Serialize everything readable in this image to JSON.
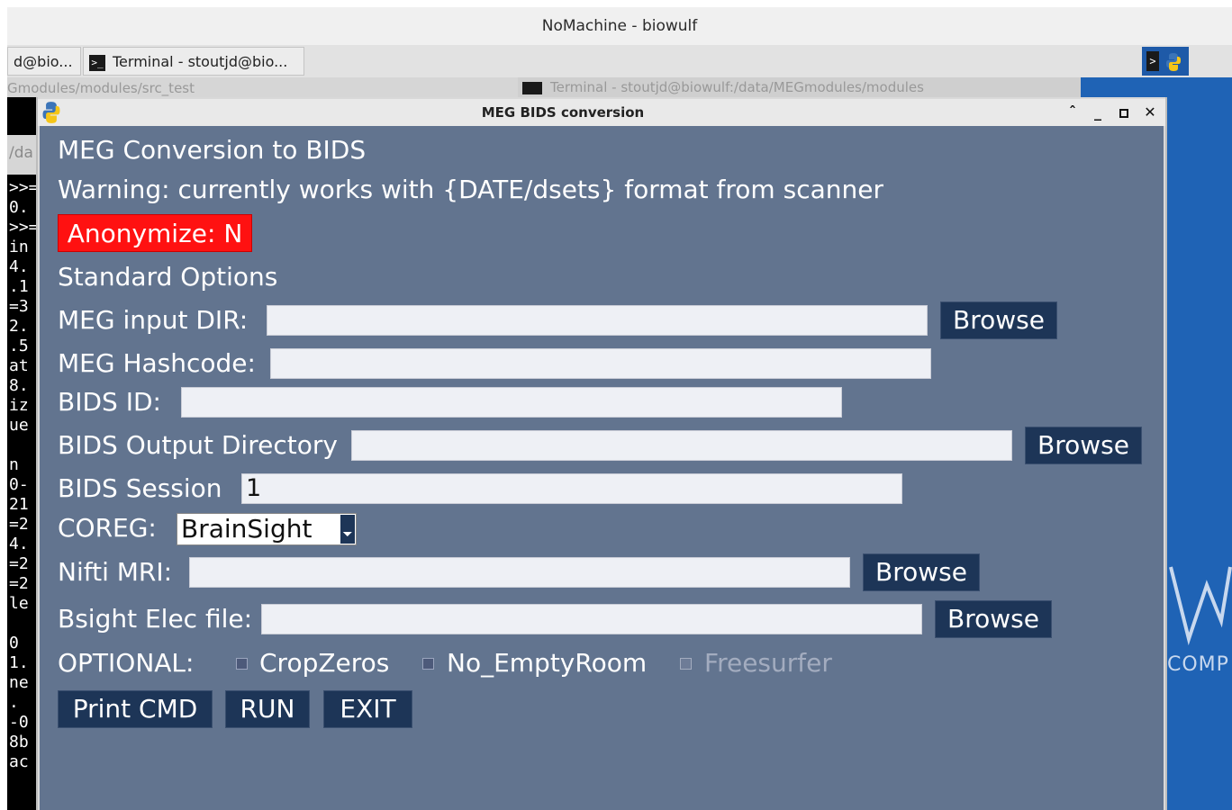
{
  "app": {
    "title": "NoMachine - biowulf"
  },
  "taskbar": {
    "items": [
      {
        "label": "d@bio..."
      },
      {
        "label": "Terminal - stoutjd@bio..."
      }
    ]
  },
  "background": {
    "left_window_title": "Gmodules/modules/src_test",
    "right_window_title": "Terminal - stoutjd@biowulf:/data/MEGmodules/modules",
    "left_path_fragment": "/da",
    "desktop_text": "COMP",
    "terminal_lines": [
      ">>=",
      "0.",
      ">>=",
      "in",
      "4.",
      ".1",
      "=3",
      "2.",
      ".5",
      "at",
      "8.",
      "iz",
      "ue",
      "",
      "n",
      "0-",
      "21",
      "=2",
      "4.",
      "=2",
      "=2",
      "le",
      "",
      "0",
      "1.",
      "ne",
      ".",
      "-0",
      "8b",
      "ac"
    ]
  },
  "dialog": {
    "title": "MEG BIDS conversion",
    "heading": "MEG Conversion to BIDS",
    "warning": "Warning: currently works with {DATE/dsets} format from scanner",
    "anonymize_label": "Anonymize: N",
    "standard_options": "Standard Options",
    "fields": {
      "meg_input_dir": {
        "label": "MEG input DIR:",
        "value": ""
      },
      "meg_hashcode": {
        "label": "MEG Hashcode:",
        "value": ""
      },
      "bids_id": {
        "label": "BIDS ID:",
        "value": ""
      },
      "bids_output_dir": {
        "label": "BIDS Output Directory",
        "value": ""
      },
      "bids_session": {
        "label": "BIDS Session",
        "value": "1"
      },
      "coreg": {
        "label": "COREG:",
        "value": "BrainSight"
      },
      "nifti_mri": {
        "label": "Nifti MRI:",
        "value": ""
      },
      "bsight_elec": {
        "label": "Bsight Elec file:",
        "value": ""
      }
    },
    "browse_label": "Browse",
    "optional": {
      "label": "OPTIONAL:",
      "options": [
        {
          "label": "CropZeros",
          "checked": false,
          "enabled": true
        },
        {
          "label": "No_EmptyRoom",
          "checked": false,
          "enabled": true
        },
        {
          "label": "Freesurfer",
          "checked": false,
          "enabled": false
        }
      ]
    },
    "buttons": {
      "print_cmd": "Print CMD",
      "run": "RUN",
      "exit": "EXIT"
    }
  },
  "colors": {
    "dialog_body": "#62748f",
    "button_bg": "#1d3557",
    "anonymize_bg": "#ff1111",
    "disabled_text": "#a3acbf",
    "desktop_blue": "#1f63b5"
  }
}
